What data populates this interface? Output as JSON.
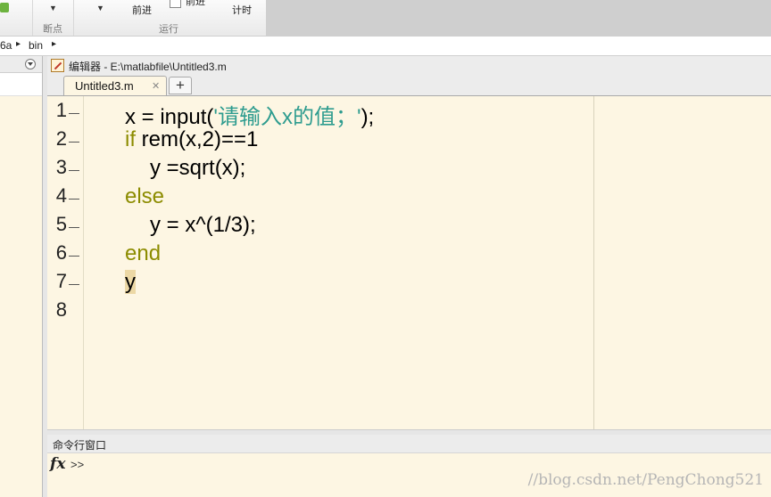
{
  "toolstrip": {
    "group_breakpoints_label": "断点",
    "group_run_label": "运行",
    "advance_label": "前进",
    "run_forward_label": "前进",
    "timer_label": "计时",
    "caret": "▼"
  },
  "addressbar": {
    "crumb_prev": "6a",
    "crumb_bin": "bin",
    "separator": "▸"
  },
  "editor": {
    "title": "编辑器 - E:\\matlabfile\\Untitled3.m",
    "tab_label": "Untitled3.m",
    "tab_close": "✕",
    "tab_add": "+",
    "lines": [
      {
        "num": "1",
        "parts": [
          {
            "t": "x = input(",
            "c": "plain"
          },
          {
            "t": "'请输入x的值；'",
            "c": "str"
          },
          {
            "t": ");",
            "c": "plain"
          }
        ]
      },
      {
        "num": "2",
        "parts": [
          {
            "t": "if",
            "c": "kw"
          },
          {
            "t": " rem(x,2)==1",
            "c": "plain"
          }
        ]
      },
      {
        "num": "3",
        "parts": [
          {
            "t": "y =sqrt(x);",
            "c": "plain"
          }
        ]
      },
      {
        "num": "4",
        "parts": [
          {
            "t": "else",
            "c": "kw"
          }
        ]
      },
      {
        "num": "5",
        "parts": [
          {
            "t": "y = x^(1/3);",
            "c": "plain"
          }
        ]
      },
      {
        "num": "6",
        "parts": [
          {
            "t": "end",
            "c": "kw"
          }
        ]
      },
      {
        "num": "7",
        "parts": [
          {
            "t": "y",
            "c": "plain"
          }
        ]
      },
      {
        "num": "8",
        "parts": []
      }
    ]
  },
  "command_window": {
    "title": "命令行窗口",
    "fx": "fx",
    "prompt": ">>",
    "watermark": "//blog.csdn.net/PengChong521"
  }
}
